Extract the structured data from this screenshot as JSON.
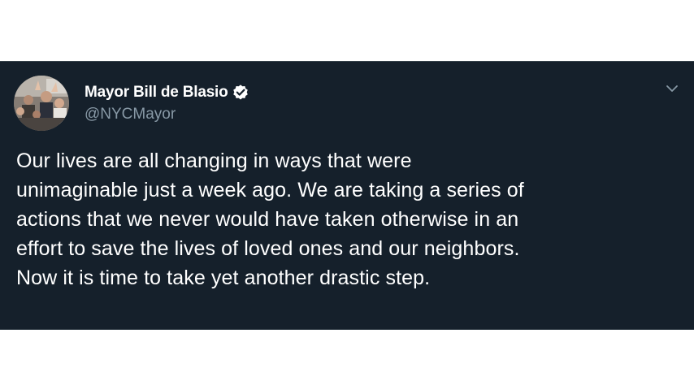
{
  "tweet": {
    "author": {
      "display_name": "Mayor Bill de Blasio",
      "handle": "@NYCMayor",
      "verified_icon": "verified-badge-icon",
      "avatar": "profile-photo-crowd"
    },
    "text": "Our lives are all changing in ways that were\nunimaginable just a week ago. We are taking a series of\nactions that we never would have taken otherwise in an\neffort to save the lives of loved ones and our neighbors.\nNow it is time to take yet another drastic step.",
    "menu_icon": "chevron-down-icon"
  },
  "colors": {
    "card_background": "#15202b",
    "text_primary": "#ffffff",
    "text_secondary": "#8899a6",
    "page_background": "#ffffff"
  }
}
